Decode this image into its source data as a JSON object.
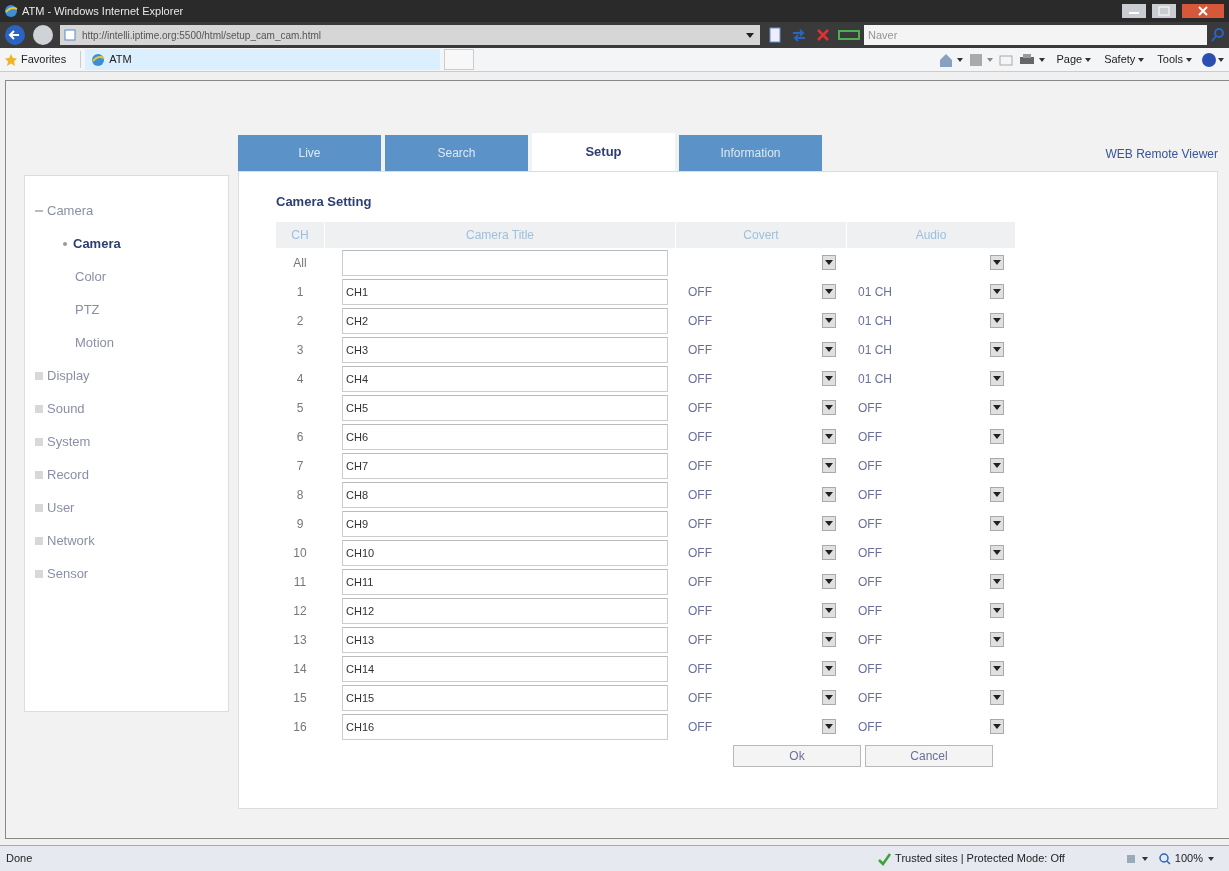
{
  "browser": {
    "title": "ATM - Windows Internet Explorer",
    "address": "http://intelli.iptime.org:5500/html/setup_cam_cam.html",
    "search_placeholder": "Naver",
    "favorites": "Favorites",
    "tab": "ATM",
    "commands": [
      "Page",
      "Safety",
      "Tools"
    ],
    "status": "Done",
    "zone": "Trusted sites | Protected Mode: Off",
    "zoom": "100%"
  },
  "tabs": [
    {
      "label": "Live",
      "selected": false
    },
    {
      "label": "Search",
      "selected": false
    },
    {
      "label": "Setup",
      "selected": true
    },
    {
      "label": "Information",
      "selected": false
    }
  ],
  "link": "WEB Remote Viewer",
  "sidebar": {
    "items": [
      {
        "label": "Camera",
        "expanded": true,
        "children": [
          {
            "label": "Camera",
            "selected": true
          },
          {
            "label": "Color",
            "selected": false
          },
          {
            "label": "PTZ",
            "selected": false
          },
          {
            "label": "Motion",
            "selected": false
          }
        ]
      },
      {
        "label": "Display",
        "expanded": false
      },
      {
        "label": "Sound",
        "expanded": false
      },
      {
        "label": "System",
        "expanded": false
      },
      {
        "label": "Record",
        "expanded": false
      },
      {
        "label": "User",
        "expanded": false
      },
      {
        "label": "Network",
        "expanded": false
      },
      {
        "label": "Sensor",
        "expanded": false
      }
    ]
  },
  "section_title": "Camera Setting",
  "table": {
    "columns": [
      "CH",
      "Camera Title",
      "Covert",
      "Audio"
    ],
    "rows": [
      {
        "ch": "All",
        "title": "",
        "covert": "",
        "audio": ""
      },
      {
        "ch": "1",
        "title": "CH1",
        "covert": "OFF",
        "audio": "01 CH"
      },
      {
        "ch": "2",
        "title": "CH2",
        "covert": "OFF",
        "audio": "01 CH"
      },
      {
        "ch": "3",
        "title": "CH3",
        "covert": "OFF",
        "audio": "01 CH"
      },
      {
        "ch": "4",
        "title": "CH4",
        "covert": "OFF",
        "audio": "01 CH"
      },
      {
        "ch": "5",
        "title": "CH5",
        "covert": "OFF",
        "audio": "OFF"
      },
      {
        "ch": "6",
        "title": "CH6",
        "covert": "OFF",
        "audio": "OFF"
      },
      {
        "ch": "7",
        "title": "CH7",
        "covert": "OFF",
        "audio": "OFF"
      },
      {
        "ch": "8",
        "title": "CH8",
        "covert": "OFF",
        "audio": "OFF"
      },
      {
        "ch": "9",
        "title": "CH9",
        "covert": "OFF",
        "audio": "OFF"
      },
      {
        "ch": "10",
        "title": "CH10",
        "covert": "OFF",
        "audio": "OFF"
      },
      {
        "ch": "11",
        "title": "CH11",
        "covert": "OFF",
        "audio": "OFF"
      },
      {
        "ch": "12",
        "title": "CH12",
        "covert": "OFF",
        "audio": "OFF"
      },
      {
        "ch": "13",
        "title": "CH13",
        "covert": "OFF",
        "audio": "OFF"
      },
      {
        "ch": "14",
        "title": "CH14",
        "covert": "OFF",
        "audio": "OFF"
      },
      {
        "ch": "15",
        "title": "CH15",
        "covert": "OFF",
        "audio": "OFF"
      },
      {
        "ch": "16",
        "title": "CH16",
        "covert": "OFF",
        "audio": "OFF"
      }
    ]
  },
  "buttons": [
    "Ok",
    "Cancel"
  ]
}
